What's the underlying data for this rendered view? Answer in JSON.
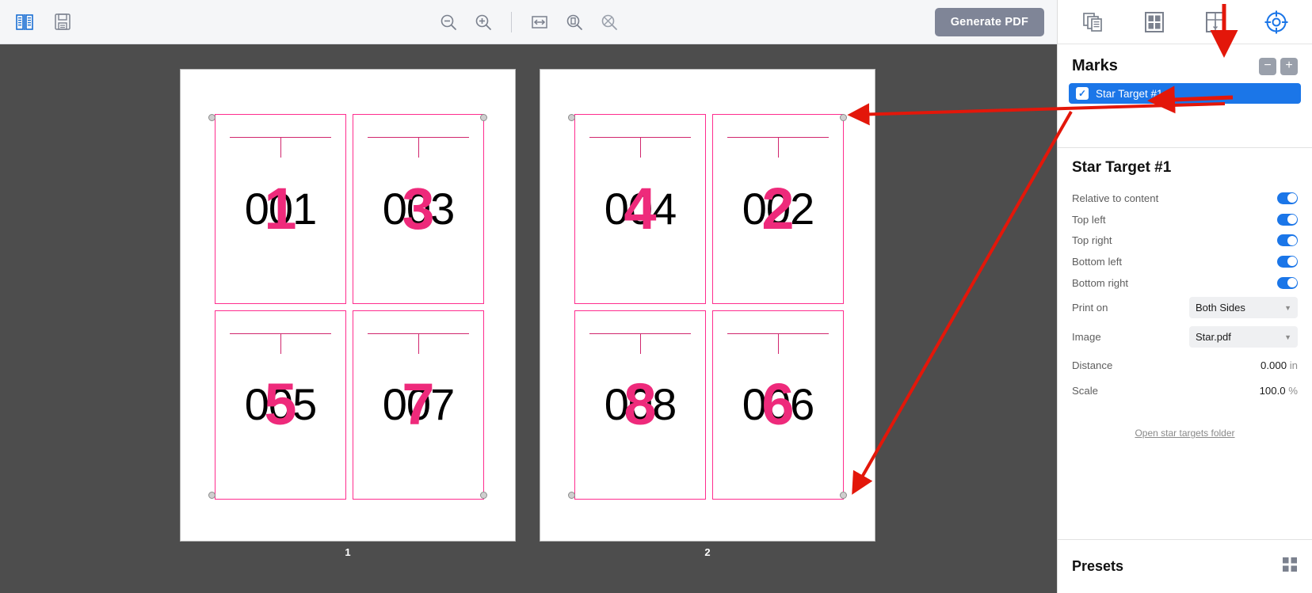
{
  "toolbar": {
    "left_icons": [
      {
        "name": "spread-view-icon",
        "label": "Spread View"
      },
      {
        "name": "save-icon",
        "label": "Save"
      }
    ],
    "center_icons": [
      {
        "name": "zoom-out-icon",
        "label": "Zoom Out"
      },
      {
        "name": "zoom-in-icon",
        "label": "Zoom In"
      },
      {
        "name": "fit-width-icon",
        "label": "Fit Width"
      },
      {
        "name": "fit-page-icon",
        "label": "Fit Page"
      },
      {
        "name": "zoom-reset-icon",
        "label": "Actual Size"
      }
    ],
    "generate_pdf_label": "Generate PDF"
  },
  "canvas": {
    "sheets": [
      {
        "page_label": "1",
        "cards": [
          {
            "black": "001",
            "pink": "1"
          },
          {
            "black": "003",
            "pink": "3"
          },
          {
            "black": "005",
            "pink": "5"
          },
          {
            "black": "007",
            "pink": "7"
          }
        ]
      },
      {
        "page_label": "2",
        "cards": [
          {
            "black": "004",
            "pink": "4"
          },
          {
            "black": "002",
            "pink": "2"
          },
          {
            "black": "008",
            "pink": "8"
          },
          {
            "black": "006",
            "pink": "6"
          }
        ]
      }
    ]
  },
  "right_panel": {
    "tabs": [
      {
        "name": "pages-tab",
        "label": "Pages",
        "selected": false
      },
      {
        "name": "layout-tab",
        "label": "Layout",
        "selected": false
      },
      {
        "name": "imposition-tab",
        "label": "Imposition",
        "selected": false
      },
      {
        "name": "marks-tab",
        "label": "Marks",
        "selected": true
      }
    ],
    "marks_header": {
      "title": "Marks",
      "remove_label": "−",
      "add_label": "+"
    },
    "marks_items": [
      {
        "label": "Star Target #1",
        "checked": true,
        "check_glyph": "✓"
      }
    ],
    "properties": {
      "title": "Star Target #1",
      "toggles": [
        {
          "label": "Relative to content",
          "on": true
        },
        {
          "label": "Top left",
          "on": true
        },
        {
          "label": "Top right",
          "on": true
        },
        {
          "label": "Bottom left",
          "on": true
        },
        {
          "label": "Bottom right",
          "on": true
        }
      ],
      "print_on": {
        "label": "Print on",
        "value": "Both Sides"
      },
      "image": {
        "label": "Image",
        "value": "Star.pdf"
      },
      "distance": {
        "label": "Distance",
        "value": "0.000",
        "unit": "in"
      },
      "scale": {
        "label": "Scale",
        "value": "100.0",
        "unit": "%"
      },
      "folder_link": "Open star targets folder"
    },
    "presets": {
      "title": "Presets",
      "grid_icon": "presets-grid-icon"
    }
  },
  "colors": {
    "accent_blue": "#1b76e8",
    "toolbar_bg": "#f5f6f8",
    "canvas_bg": "#4d4d4d",
    "mark_pink": "#ee2a7b",
    "annotation_red": "#e3170a",
    "button_gray": "#7f8597"
  }
}
